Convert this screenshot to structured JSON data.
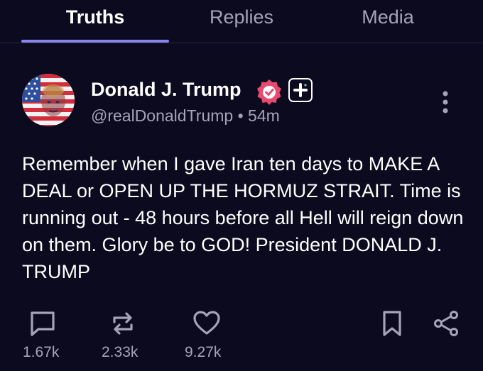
{
  "tabs": [
    {
      "label": "Truths",
      "active": true
    },
    {
      "label": "Replies",
      "active": false
    },
    {
      "label": "Media",
      "active": false
    }
  ],
  "post": {
    "author_name": "Donald J. Trump",
    "handle": "@realDonaldTrump",
    "separator": "•",
    "time": "54m",
    "text": "Remember when I gave Iran ten days to MAKE A DEAL or OPEN UP THE HORMUZ STRAIT. Time is running out - 48 hours before all Hell will reign down on them. Glory be to GOD! President DONALD J. TRUMP",
    "verified_icon": "verified-check-icon",
    "badge_icon": "plus-icon",
    "more_icon": "vertical-dots-icon"
  },
  "actions": {
    "reply": {
      "icon": "reply-icon",
      "count": "1.67k"
    },
    "retruth": {
      "icon": "repost-icon",
      "count": "2.33k"
    },
    "like": {
      "icon": "heart-icon",
      "count": "9.27k"
    },
    "bookmark": {
      "icon": "bookmark-icon"
    },
    "share": {
      "icon": "share-icon"
    }
  },
  "colors": {
    "background": "#0c0a1f",
    "accent": "#8a86f0",
    "verified": "#e84a6f",
    "muted": "#a6a3b8"
  }
}
